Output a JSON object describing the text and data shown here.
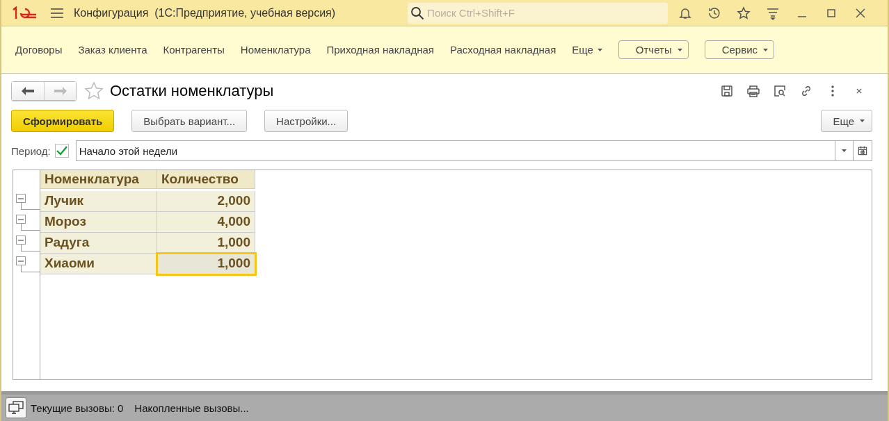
{
  "window": {
    "title": "Конфигурация  (1С:Предприятие, учебная версия)"
  },
  "search": {
    "placeholder": "Поиск Ctrl+Shift+F"
  },
  "nav": {
    "items": [
      {
        "label": "Договоры",
        "kind": "link"
      },
      {
        "label": "Заказ клиента",
        "kind": "link"
      },
      {
        "label": "Контрагенты",
        "kind": "link"
      },
      {
        "label": "Номенклатура",
        "kind": "link"
      },
      {
        "label": "Приходная накладная",
        "kind": "link"
      },
      {
        "label": "Расходная накладная",
        "kind": "link"
      },
      {
        "label": "Еще",
        "kind": "more"
      },
      {
        "label": "Отчеты",
        "kind": "button"
      },
      {
        "label": "Сервис",
        "kind": "button"
      }
    ]
  },
  "form": {
    "title": "Остатки номенклатуры",
    "favorite": false,
    "buttons": [
      {
        "label": "Сформировать",
        "kind": "primary"
      },
      {
        "label": "Выбрать вариант...",
        "kind": "normal"
      },
      {
        "label": "Настройки...",
        "kind": "normal"
      }
    ],
    "more_button": "Еще",
    "period": {
      "label": "Период:",
      "checked": true,
      "value": "Начало этой недели"
    }
  },
  "report": {
    "columns": [
      "Номенклатура",
      "Количество"
    ],
    "rows": [
      {
        "name": "Лучик",
        "quantity": "2,000",
        "expanded": true,
        "selected": false
      },
      {
        "name": "Мороз",
        "quantity": "4,000",
        "expanded": true,
        "selected": false
      },
      {
        "name": "Радуга",
        "quantity": "1,000",
        "expanded": true,
        "selected": false
      },
      {
        "name": "Хиаоми",
        "quantity": "1,000",
        "expanded": true,
        "selected": true
      }
    ]
  },
  "status_bar": {
    "current_calls": "Текущие вызовы: 0",
    "accumulated_calls": "Накопленные вызовы..."
  }
}
